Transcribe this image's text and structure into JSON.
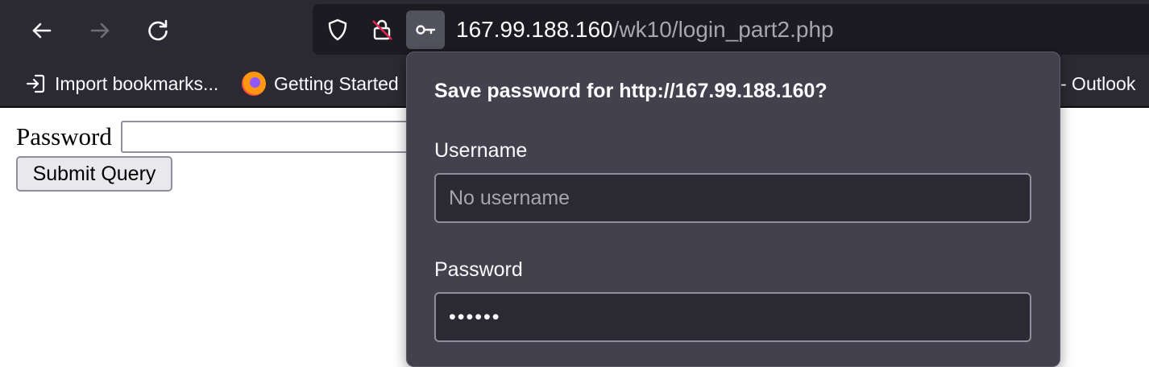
{
  "browser": {
    "url_host": "167.99.188.160",
    "url_path": "/wk10/login_part2.php",
    "bookmarks": [
      {
        "label": "Import bookmarks..."
      },
      {
        "label": "Getting Started"
      },
      {
        "label": "- Outlook"
      }
    ]
  },
  "page": {
    "password_label": "Password",
    "submit_label": "Submit Query"
  },
  "popup": {
    "title": "Save password for http://167.99.188.160?",
    "username_label": "Username",
    "username_placeholder": "No username",
    "password_label": "Password",
    "password_value": "••••••"
  },
  "colors": {
    "toolbar_bg": "#2b2a33",
    "urlbar_bg": "#1c1b22",
    "popup_bg": "#42414d"
  }
}
